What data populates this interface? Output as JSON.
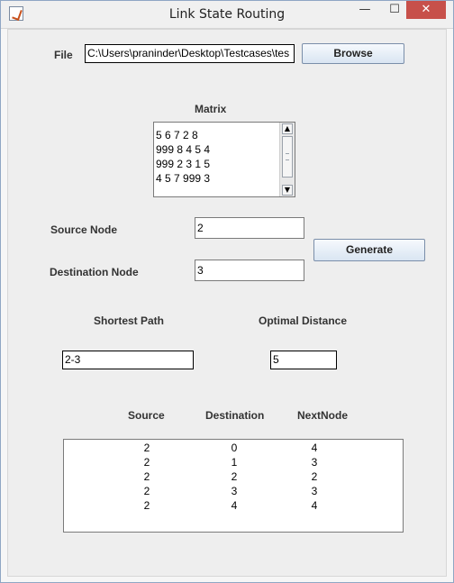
{
  "window": {
    "title": "Link State Routing",
    "app_icon": "java-icon",
    "min_icon": "minimize-icon",
    "max_icon": "maximize-icon",
    "close_icon": "close-icon"
  },
  "file": {
    "label": "File",
    "path": "C:\\Users\\praninder\\Desktop\\Testcases\\tes",
    "browse_label": "Browse"
  },
  "matrix": {
    "label": "Matrix",
    "lines": [
      "5 6 7 2 8",
      "999 8 4 5 4",
      "999 2 3 1 5",
      "4 5 7 999 3"
    ]
  },
  "source_node": {
    "label": "Source Node",
    "value": "2"
  },
  "destination_node": {
    "label": "Destination Node",
    "value": "3"
  },
  "generate_label": "Generate",
  "shortest_path": {
    "label": "Shortest Path",
    "value": "2-3"
  },
  "optimal_distance": {
    "label": "Optimal Distance",
    "value": "5"
  },
  "table": {
    "headers": [
      "Source",
      "Destination",
      "NextNode"
    ],
    "rows": [
      [
        "2",
        "0",
        "4"
      ],
      [
        "2",
        "1",
        "3"
      ],
      [
        "2",
        "2",
        "2"
      ],
      [
        "2",
        "3",
        "3"
      ],
      [
        "2",
        "4",
        "4"
      ]
    ]
  }
}
